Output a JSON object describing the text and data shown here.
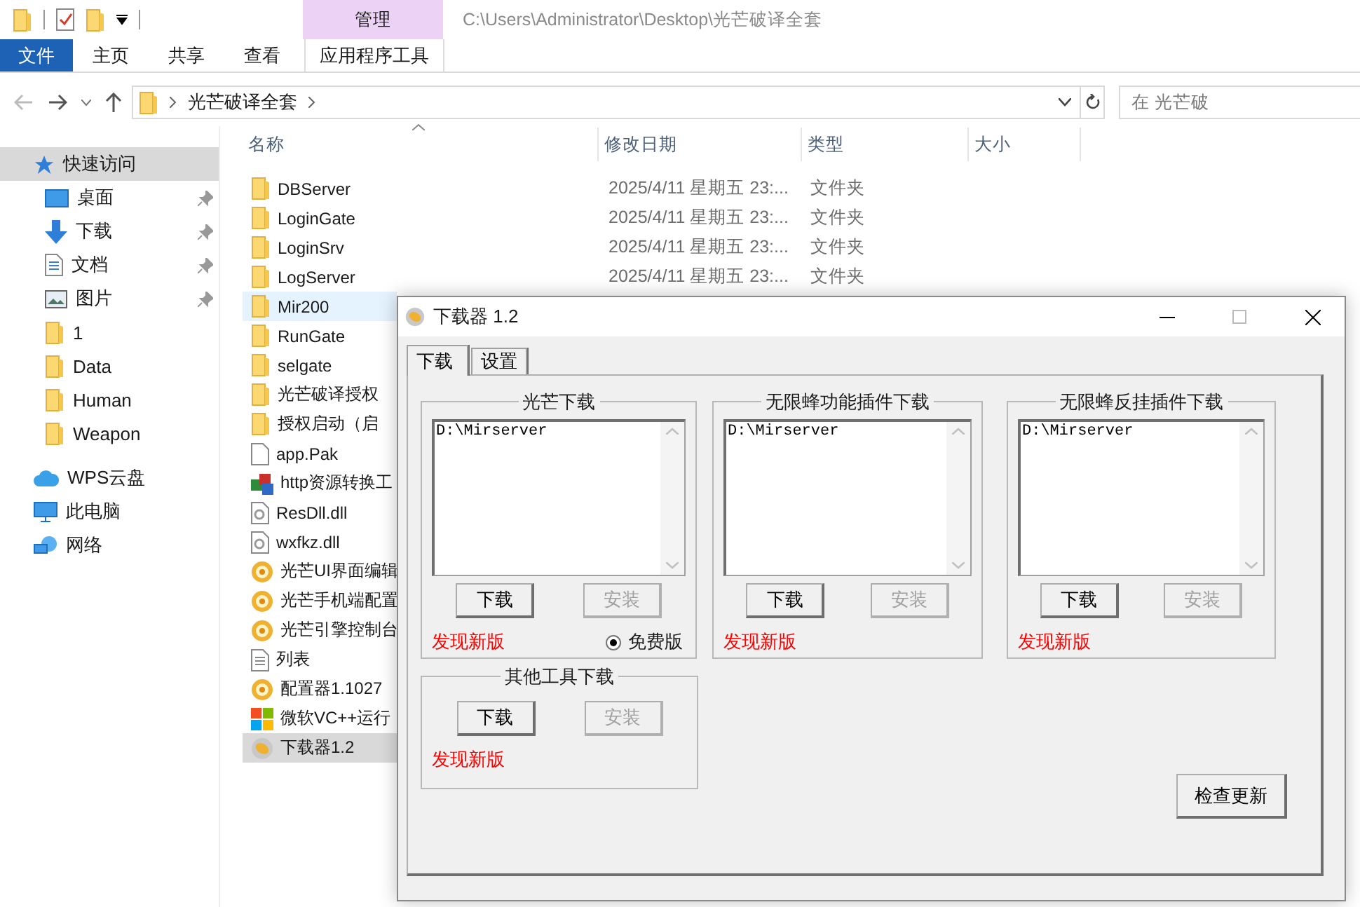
{
  "window": {
    "title": "C:\\Users\\Administrator\\Desktop\\光芒破译全套",
    "context_group": "管理"
  },
  "ribbon_tabs": [
    {
      "label": "文件",
      "kind": "file"
    },
    {
      "label": "主页",
      "kind": "normal"
    },
    {
      "label": "共享",
      "kind": "normal"
    },
    {
      "label": "查看",
      "kind": "normal"
    },
    {
      "label": "应用程序工具",
      "kind": "contextual"
    }
  ],
  "address_bar": {
    "path": [
      "光芒破译全套"
    ]
  },
  "search": {
    "placeholder": "在 光芒破"
  },
  "navigation": [
    {
      "label": "快速访问",
      "kind": "star",
      "selected": true,
      "children": [
        {
          "label": "桌面",
          "kind": "desktop",
          "pinned": true,
          "selected": false
        },
        {
          "label": "下载",
          "kind": "download",
          "pinned": true,
          "selected": false
        },
        {
          "label": "文档",
          "kind": "document",
          "pinned": true,
          "selected": false
        },
        {
          "label": "图片",
          "kind": "picture",
          "pinned": true,
          "selected": false
        },
        {
          "label": "1",
          "kind": "folder",
          "pinned": false,
          "selected": false
        },
        {
          "label": "Data",
          "kind": "folder",
          "pinned": false,
          "selected": false
        },
        {
          "label": "Human",
          "kind": "folder",
          "pinned": false,
          "selected": false
        },
        {
          "label": "Weapon",
          "kind": "folder",
          "pinned": false,
          "selected": false
        }
      ]
    },
    {
      "label": "WPS云盘",
      "kind": "cloud",
      "selected": false
    },
    {
      "label": "此电脑",
      "kind": "pc",
      "selected": false
    },
    {
      "label": "网络",
      "kind": "network",
      "selected": false
    }
  ],
  "columns": [
    {
      "label": "名称",
      "sorted": true
    },
    {
      "label": "修改日期",
      "sorted": false
    },
    {
      "label": "类型",
      "sorted": false
    },
    {
      "label": "大小",
      "sorted": false
    }
  ],
  "files": [
    {
      "name": "DBServer",
      "kind": "folder",
      "modified": "2025/4/11 星期五 23:...",
      "type": "文件夹",
      "hovered": false,
      "selected": false
    },
    {
      "name": "LoginGate",
      "kind": "folder",
      "modified": "2025/4/11 星期五 23:...",
      "type": "文件夹",
      "hovered": false,
      "selected": false
    },
    {
      "name": "LoginSrv",
      "kind": "folder",
      "modified": "2025/4/11 星期五 23:...",
      "type": "文件夹",
      "hovered": false,
      "selected": false
    },
    {
      "name": "LogServer",
      "kind": "folder",
      "modified": "2025/4/11 星期五 23:...",
      "type": "文件夹",
      "hovered": false,
      "selected": false
    },
    {
      "name": "Mir200",
      "kind": "folder",
      "hovered": true,
      "selected": false
    },
    {
      "name": "RunGate",
      "kind": "folder",
      "hovered": false,
      "selected": false
    },
    {
      "name": "selgate",
      "kind": "folder",
      "hovered": false,
      "selected": false
    },
    {
      "name": "光芒破译授权",
      "kind": "folder",
      "hovered": false,
      "selected": false
    },
    {
      "name": "授权启动（启",
      "kind": "folder",
      "hovered": false,
      "selected": false
    },
    {
      "name": "app.Pak",
      "kind": "blank",
      "hovered": false,
      "selected": false
    },
    {
      "name": "http资源转换工",
      "kind": "office",
      "hovered": false,
      "selected": false
    },
    {
      "name": "ResDll.dll",
      "kind": "dll",
      "hovered": false,
      "selected": false
    },
    {
      "name": "wxfkz.dll",
      "kind": "dll",
      "hovered": false,
      "selected": false
    },
    {
      "name": "光芒UI界面编辑",
      "kind": "gear",
      "hovered": false,
      "selected": false
    },
    {
      "name": "光芒手机端配置",
      "kind": "gear",
      "hovered": false,
      "selected": false
    },
    {
      "name": "光芒引擎控制台",
      "kind": "gear",
      "hovered": false,
      "selected": false
    },
    {
      "name": "列表",
      "kind": "text",
      "hovered": false,
      "selected": false
    },
    {
      "name": "配置器1.1027",
      "kind": "gear",
      "hovered": false,
      "selected": false
    },
    {
      "name": "微软VC++运行",
      "kind": "tiles",
      "hovered": false,
      "selected": false
    },
    {
      "name": "下载器1.2",
      "kind": "loader",
      "hovered": false,
      "selected": true
    }
  ],
  "dialog": {
    "title": "下载器 1.2",
    "tabs": [
      {
        "label": "下载",
        "selected": true
      },
      {
        "label": "设置",
        "selected": false
      }
    ],
    "groups": [
      {
        "title": "光芒下载",
        "path": "D:\\Mirserver",
        "buttons": [
          {
            "label": "下载",
            "disabled": false
          },
          {
            "label": "安装",
            "disabled": true
          }
        ],
        "notice": "发现新版",
        "option": {
          "label": "免费版",
          "checked": true
        }
      },
      {
        "title": "无限蜂功能插件下载",
        "path": "D:\\Mirserver",
        "buttons": [
          {
            "label": "下载",
            "disabled": false
          },
          {
            "label": "安装",
            "disabled": true
          }
        ],
        "notice": "发现新版"
      },
      {
        "title": "无限蜂反挂插件下载",
        "path": "D:\\Mirserver",
        "buttons": [
          {
            "label": "下载",
            "disabled": false
          },
          {
            "label": "安装",
            "disabled": true
          }
        ],
        "notice": "发现新版"
      },
      {
        "title": "其他工具下载",
        "buttons": [
          {
            "label": "下载",
            "disabled": false
          },
          {
            "label": "安装",
            "disabled": true
          }
        ],
        "notice": "发现新版"
      }
    ],
    "update_button": "检查更新"
  }
}
